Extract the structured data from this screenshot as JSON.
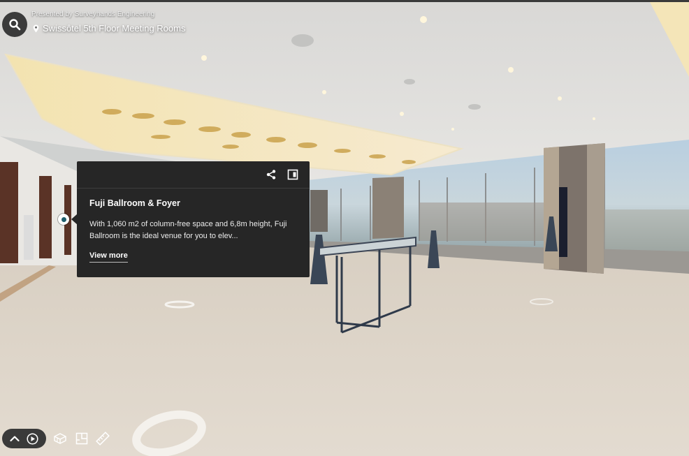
{
  "header": {
    "presented_by": "Presented by Surveyhands Engineering",
    "location_title": "Swissôtel 5th Floor Meeting Rooms"
  },
  "icons": {
    "search": "search-icon",
    "location": "location-pin-icon",
    "share": "share-icon",
    "dock": "dock-panel-icon",
    "tag": "mattertag-pin-icon",
    "expand": "chevron-up-icon",
    "play": "play-icon",
    "dollhouse": "dollhouse-icon",
    "floorplan": "floorplan-icon",
    "measure": "measure-icon"
  },
  "tag_card": {
    "title": "Fuji Ballroom & Foyer",
    "description": "With 1,060 m2 of column-free space and 6,8m height, Fuji Ballroom is the ideal venue for you to elev...",
    "more_label": "View more"
  },
  "colors": {
    "card_bg": "#262626",
    "tag_accent": "#1f5f6d",
    "toolbar_bg": "#3a3a3a"
  }
}
